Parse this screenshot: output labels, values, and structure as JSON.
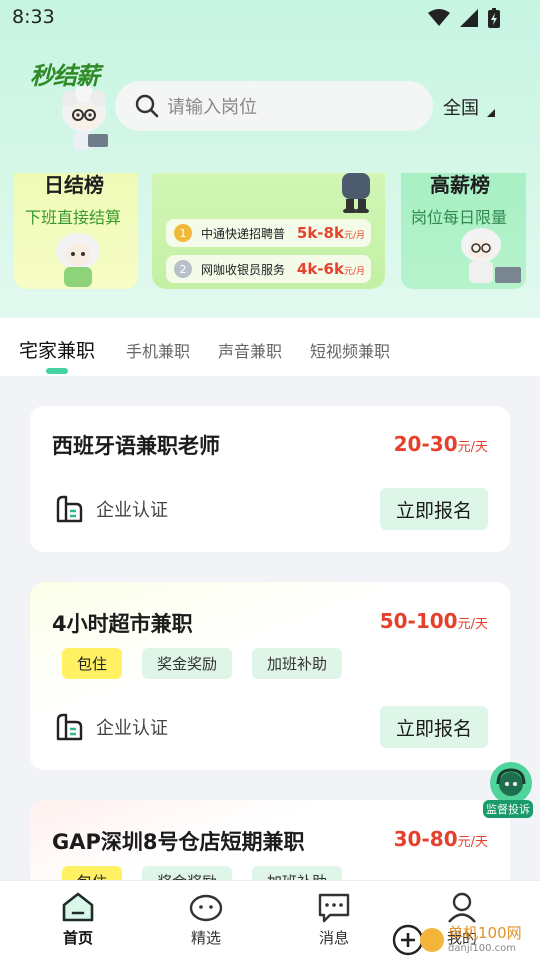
{
  "status_bar": {
    "time": "8:33"
  },
  "app": {
    "logo_text": "秒结薪"
  },
  "search": {
    "placeholder": "请输入岗位"
  },
  "region": {
    "label": "全国"
  },
  "banners": {
    "left": {
      "title": "日结榜",
      "subtitle": "下班直接结算"
    },
    "middle": {
      "items": [
        {
          "rank": "1",
          "name": "中通快递招聘普",
          "salary": "5k-8k",
          "unit": "元/月"
        },
        {
          "rank": "2",
          "name": "网咖收银员服务",
          "salary": "4k-6k",
          "unit": "元/月"
        }
      ]
    },
    "right": {
      "title": "高薪榜",
      "subtitle": "岗位每日限量"
    }
  },
  "tabs": [
    {
      "label": "宅家兼职",
      "active": true
    },
    {
      "label": "手机兼职"
    },
    {
      "label": "声音兼职"
    },
    {
      "label": "短视频兼职"
    }
  ],
  "jobs": [
    {
      "title": "西班牙语兼职老师",
      "salary": "20-30",
      "unit": "元/天",
      "tags": [],
      "cert": "企业认证",
      "apply": "立即报名"
    },
    {
      "title": "4小时超市兼职",
      "salary": "50-100",
      "unit": "元/天",
      "tags": [
        "包住",
        "奖金奖励",
        "加班补助"
      ],
      "cert": "企业认证",
      "apply": "立即报名"
    },
    {
      "title": "GAP深圳8号仓店短期兼职",
      "salary": "30-80",
      "unit": "元/天",
      "tags": [
        "包住",
        "奖金奖励",
        "加班补助"
      ]
    }
  ],
  "floating": {
    "complaint_label": "监督投诉"
  },
  "bottom_nav": [
    {
      "label": "首页",
      "active": true
    },
    {
      "label": "精选"
    },
    {
      "label": "消息"
    },
    {
      "label": "我的"
    }
  ],
  "watermark": {
    "text": "单机100网",
    "url_text": "danji100.com"
  },
  "colors": {
    "accent": "#43d3a0",
    "salary_red": "#e5402c",
    "tag_yellow": "#fff064",
    "tag_green": "#dff5e7"
  }
}
